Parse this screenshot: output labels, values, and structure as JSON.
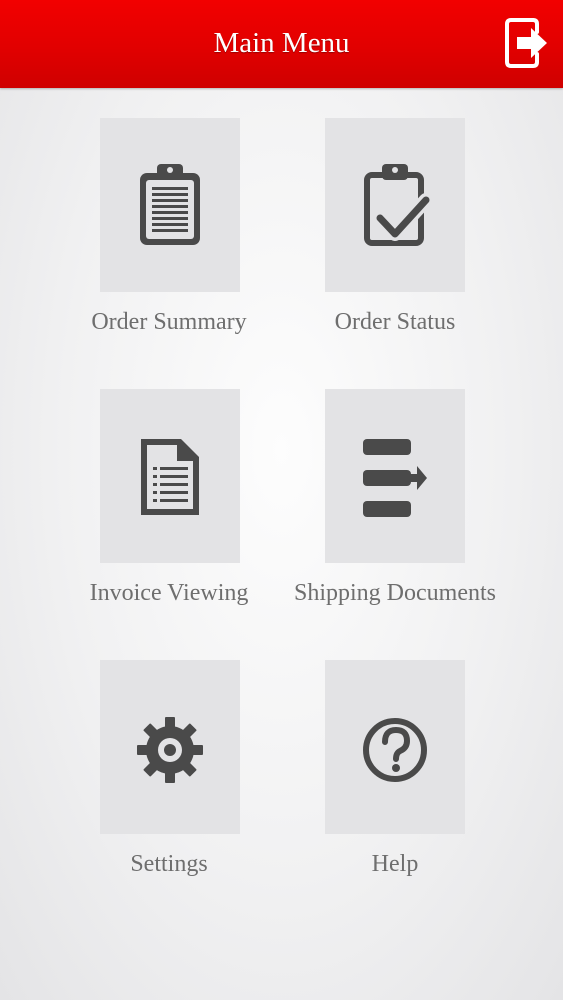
{
  "header": {
    "title": "Main Menu",
    "logout_icon": "logout-icon",
    "background_color": "#e80000"
  },
  "menu": {
    "items": [
      {
        "label": "Order Summary",
        "icon": "clipboard-list-icon"
      },
      {
        "label": "Order Status",
        "icon": "clipboard-check-icon"
      },
      {
        "label": "Invoice Viewing",
        "icon": "document-icon"
      },
      {
        "label": "Shipping Documents",
        "icon": "shipping-documents-icon"
      },
      {
        "label": "Settings",
        "icon": "gear-icon"
      },
      {
        "label": "Help",
        "icon": "help-icon"
      }
    ]
  },
  "colors": {
    "icon": "#4a4a4a",
    "tile": "#e3e3e5",
    "label": "#6e6e6e"
  }
}
